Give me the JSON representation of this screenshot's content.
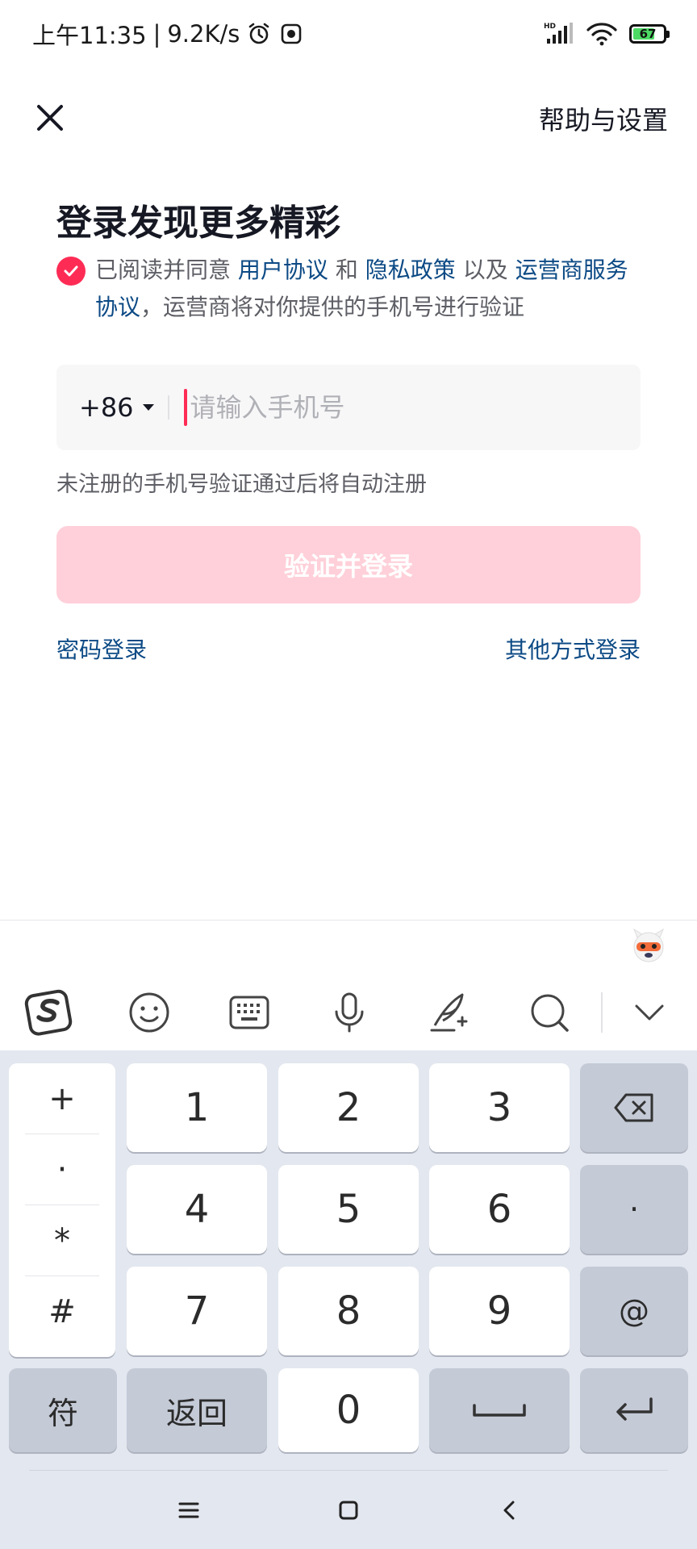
{
  "status_bar": {
    "time": "上午11:35",
    "separator": "|",
    "speed": "9.2K/s",
    "network_label": "HD",
    "battery_level": "67"
  },
  "header": {
    "help_label": "帮助与设置"
  },
  "login": {
    "title": "登录发现更多精彩",
    "agreement": {
      "prefix": "已阅读并同意",
      "user_agreement": "用户协议",
      "and": "和",
      "privacy_policy": "隐私政策",
      "as_well_as": "以及",
      "carrier_agreement_part1": "运营商服务",
      "carrier_agreement_part2": "协议",
      "suffix": "，运营商将对你提供的手机号进行验证",
      "checked": true
    },
    "country_code": "+86",
    "phone_value": "",
    "phone_placeholder": "请输入手机号",
    "hint": "未注册的手机号验证通过后将自动注册",
    "submit_label": "验证并登录",
    "password_login": "密码登录",
    "other_login": "其他方式登录"
  },
  "keyboard": {
    "symbols": [
      "+",
      "·",
      "*",
      "#"
    ],
    "digits": [
      "1",
      "2",
      "3",
      "4",
      "5",
      "6",
      "7",
      "8",
      "9",
      "0"
    ],
    "dot_key": "·",
    "at_key": "@",
    "symbol_key": "符",
    "back_key": "返回"
  },
  "colors": {
    "accent": "#fe2c55",
    "link": "#0c4a85",
    "button_disabled": "#ffd0d9",
    "keyboard_bg": "#e3e7ef"
  }
}
